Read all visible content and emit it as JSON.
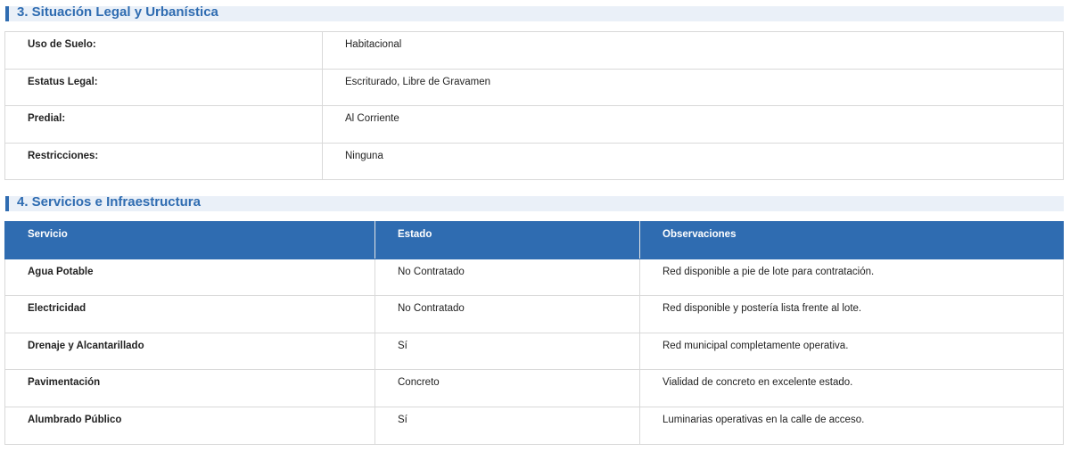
{
  "section3": {
    "title": "3. Situación Legal y Urbanística",
    "rows": [
      {
        "label": "Uso de Suelo:",
        "value": "Habitacional"
      },
      {
        "label": "Estatus Legal:",
        "value": "Escriturado, Libre de Gravamen"
      },
      {
        "label": "Predial:",
        "value": "Al Corriente"
      },
      {
        "label": "Restricciones:",
        "value": "Ninguna"
      }
    ]
  },
  "section4": {
    "title": "4. Servicios e Infraestructura",
    "columns": [
      "Servicio",
      "Estado",
      "Observaciones"
    ],
    "rows": [
      {
        "service": "Agua Potable",
        "status": "No Contratado",
        "notes": "Red disponible a pie de lote para contratación."
      },
      {
        "service": "Electricidad",
        "status": "No Contratado",
        "notes": "Red disponible y postería lista frente al lote."
      },
      {
        "service": "Drenaje y Alcantarillado",
        "status": "Sí",
        "notes": "Red municipal completamente operativa."
      },
      {
        "service": "Pavimentación",
        "status": "Concreto",
        "notes": "Vialidad de concreto en excelente estado."
      },
      {
        "service": "Alumbrado Público",
        "status": "Sí",
        "notes": "Luminarias operativas en la calle de acceso."
      }
    ]
  },
  "colors": {
    "accent": "#2f6cb1",
    "header_bg": "#eaf0f8",
    "border": "#d9d9d9"
  }
}
